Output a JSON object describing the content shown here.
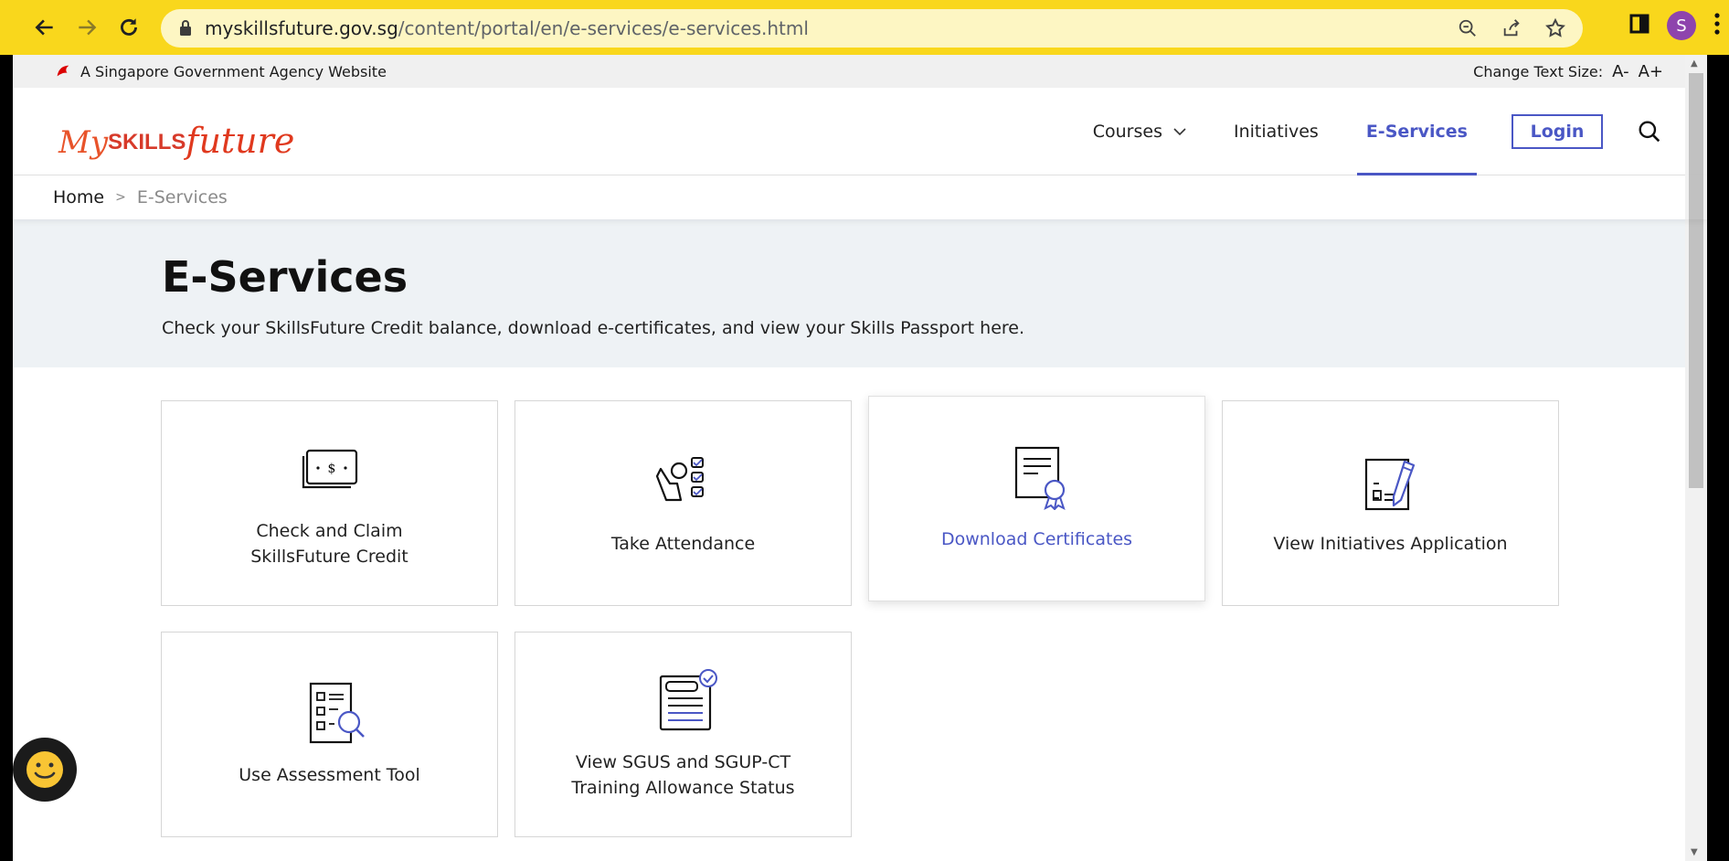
{
  "browser": {
    "url_domain": "myskillsfuture.gov.sg",
    "url_path": "/content/portal/en/e-services/e-services.html",
    "profile_initial": "S"
  },
  "gov_bar": {
    "text": "A Singapore Government Agency Website",
    "text_size_label": "Change Text Size:",
    "decrease": "A-",
    "increase": "A+"
  },
  "header": {
    "logo": {
      "my": "My",
      "skills": "SKILLS",
      "future": "future"
    },
    "nav": {
      "courses": "Courses",
      "initiatives": "Initiatives",
      "eservices": "E-Services",
      "login": "Login"
    }
  },
  "breadcrumb": {
    "home": "Home",
    "current": "E-Services"
  },
  "hero": {
    "title": "E-Services",
    "subtitle": "Check your SkillsFuture Credit balance, download e-certificates, and view your Skills Passport here."
  },
  "cards": [
    {
      "label": "Check and Claim\nSkillsFuture Credit",
      "icon": "money-icon"
    },
    {
      "label": "Take Attendance",
      "icon": "attendance-icon"
    },
    {
      "label": "Download Certificates",
      "icon": "certificate-icon"
    },
    {
      "label": "View Initiatives Application",
      "icon": "application-icon"
    },
    {
      "label": "Use Assessment Tool",
      "icon": "assessment-icon"
    },
    {
      "label": "View SGUS and SGUP-CT\nTraining Allowance Status",
      "icon": "allowance-status-icon"
    }
  ],
  "colors": {
    "accent": "#4a57c5",
    "brand_red": "#e0391e",
    "chrome_yellow": "#f9d71c"
  }
}
